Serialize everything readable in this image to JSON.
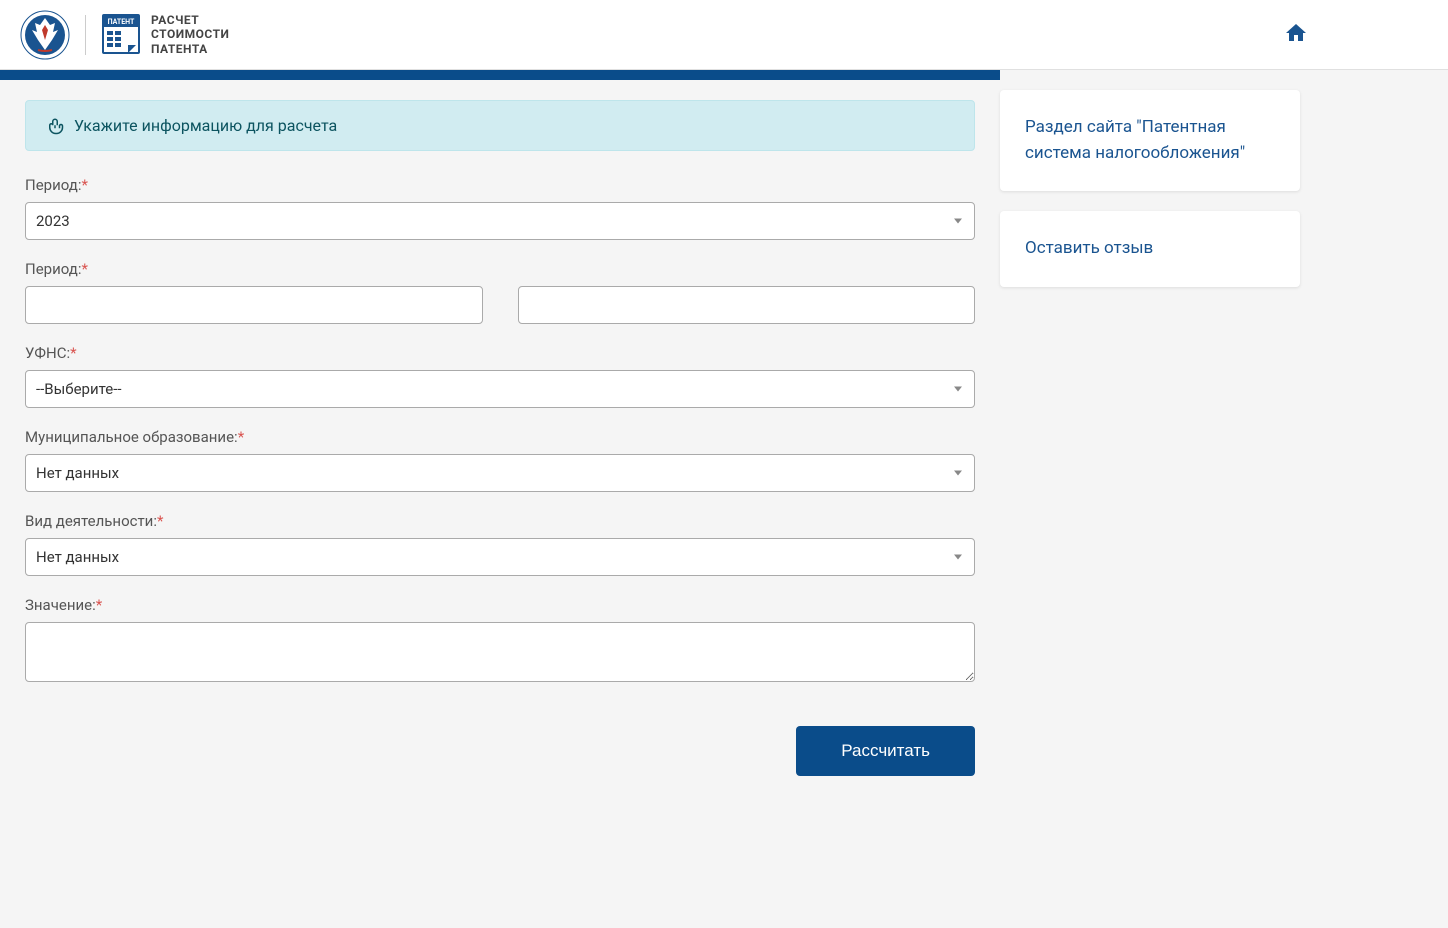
{
  "header": {
    "title_line1": "РАСЧЕТ",
    "title_line2": "СТОИМОСТИ",
    "title_line3": "ПАТЕНТА",
    "patent_badge": "ПАТЕНТ"
  },
  "banner": {
    "text": "Укажите информацию для расчета"
  },
  "form": {
    "period_year": {
      "label": "Период:",
      "value": "2023"
    },
    "period_range": {
      "label": "Период:",
      "from_value": "",
      "to_value": ""
    },
    "ufns": {
      "label": "УФНС:",
      "value": "--Выберите--"
    },
    "municipality": {
      "label": "Муниципальное образование:",
      "value": "Нет данных"
    },
    "activity_type": {
      "label": "Вид деятельности:",
      "value": "Нет данных"
    },
    "value_field": {
      "label": "Значение:",
      "value": ""
    },
    "calculate_button": "Рассчитать"
  },
  "sidebar": {
    "link1": "Раздел сайта \"Патентная система налогообложения\"",
    "link2": "Оставить отзыв"
  }
}
